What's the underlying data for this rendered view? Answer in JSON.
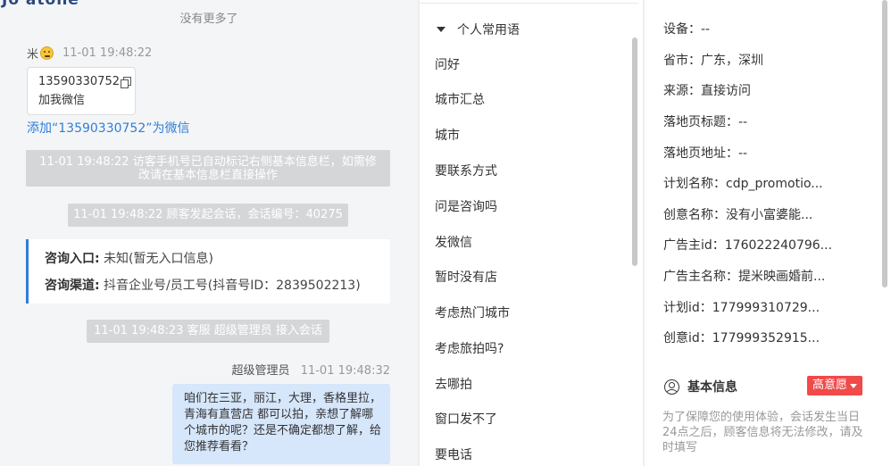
{
  "chat": {
    "top_cut_text": "Jo atone",
    "no_more": "没有更多了",
    "visitor": {
      "name": "米",
      "time": "11-01 19:48:22"
    },
    "card": {
      "phone": "13590330752",
      "label": "加我微信"
    },
    "add_link": "添加“13590330752”为微信",
    "system_msg_1": "11-01 19:48:22 访客手机号已自动标记右侧基本信息栏，如需修改请在基本信息栏直接操作",
    "system_msg_2": "11-01 19:48:22 顾客发起会话，会话编号：40275",
    "entry": {
      "entry_label": "咨询入口:",
      "entry_value": " 未知(暂无入口信息)",
      "channel_label": "咨询渠道:",
      "channel_value": " 抖音企业号/员工号(抖音号ID：2839502213)"
    },
    "system_msg_3": "11-01 19:48:23 客服 超级管理员 接入会话",
    "agent": {
      "name": "超级管理员",
      "time": "11-01 19:48:32"
    },
    "agent_message": "咱们在三亚，丽江，大理，香格里拉，青海有直营店 都可以拍，亲想了解哪个城市的呢？还是不确定都想了解，给您推荐看看？"
  },
  "phrases": {
    "group_title": "个人常用语",
    "items": [
      "问好",
      "城市汇总",
      "城市",
      "要联系方式",
      "问是咨询吗",
      "发微信",
      "暂时没有店",
      "考虑热门城市",
      "考虑旅拍吗?",
      "去哪拍",
      "窗口发不了",
      "要电话"
    ]
  },
  "info": {
    "fields": [
      "设备：--",
      "省市：广东，深圳",
      "来源：直接访问",
      "落地页标题：--",
      "落地页地址：--",
      "计划名称：cdp_promotio...",
      "创意名称：没有小富婆能...",
      "广告主id：176022240796...",
      "广告主名称：提米映画婚前...",
      "计划id：177999310729...",
      "创意id：177999352915..."
    ],
    "basic_title": "基本信息",
    "intent_badge": "高意愿",
    "notice": "为了保障您的使用体验，会话发生当日24点之后，顾客信息将无法修改，请及时填写"
  }
}
